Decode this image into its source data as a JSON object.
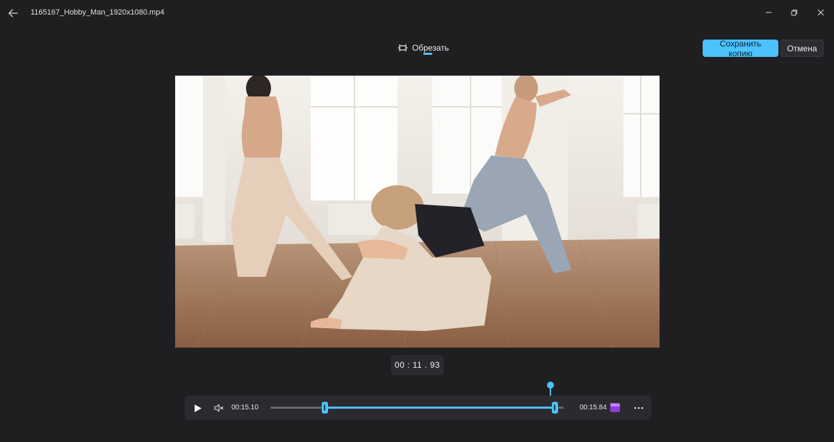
{
  "window": {
    "filename": "1165167_Hobby_Man_1920x1080.mp4"
  },
  "icons": {
    "back": "arrow-left-icon",
    "minimize": "minimize-icon",
    "restore": "restore-icon",
    "close": "close-icon",
    "trim": "trim-icon",
    "play": "play-icon",
    "mute": "mute-icon",
    "clipchamp": "clipchamp-icon",
    "more": "more-icon"
  },
  "toolbar": {
    "tab_label": "Обрезать",
    "save_label": "Сохранить копию",
    "cancel_label": "Отмена"
  },
  "player": {
    "current_time": "00 : 11 . 93",
    "trim_start": "00:15.10",
    "trim_end": "00:15.84",
    "playhead_fraction": 0.99,
    "selection_start_fraction": 0.19,
    "selection_end_fraction": 0.99
  },
  "colors": {
    "accent": "#4cc2ff",
    "background": "#1f1f22",
    "panel": "#2b2b2f"
  }
}
